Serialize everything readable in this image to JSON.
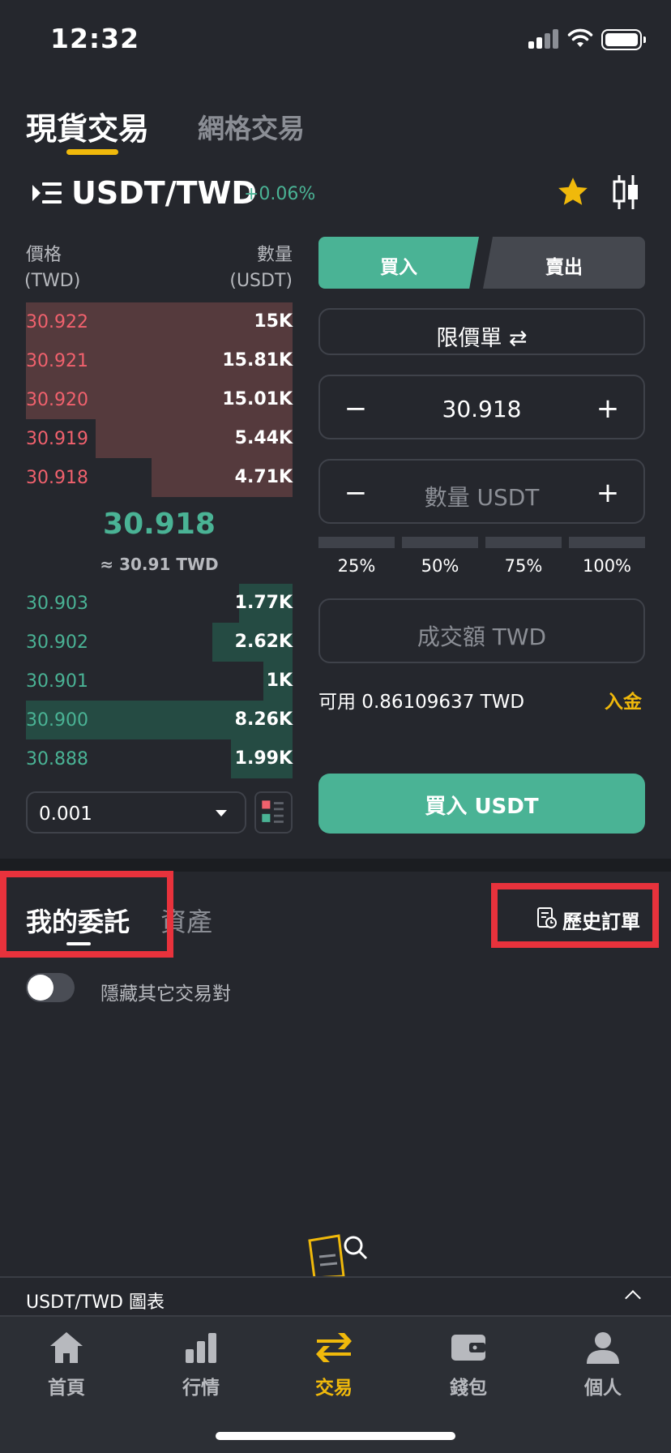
{
  "status_bar": {
    "time": "12:32"
  },
  "trade_tabs": {
    "spot": "現貨交易",
    "grid": "網格交易"
  },
  "pair": {
    "name": "USDT/TWD",
    "change": "+0.06%"
  },
  "orderbook": {
    "price_header": "價格",
    "price_unit": "(TWD)",
    "qty_header": "數量",
    "qty_unit": "(USDT)",
    "asks": [
      {
        "price": "30.922",
        "qty": "15K",
        "depth": 1.0
      },
      {
        "price": "30.921",
        "qty": "15.81K",
        "depth": 1.0
      },
      {
        "price": "30.920",
        "qty": "15.01K",
        "depth": 1.0
      },
      {
        "price": "30.919",
        "qty": "5.44K",
        "depth": 0.74
      },
      {
        "price": "30.918",
        "qty": "4.71K",
        "depth": 0.53
      }
    ],
    "last_price": "30.918",
    "last_price_fiat": "≈ 30.91 TWD",
    "bids": [
      {
        "price": "30.903",
        "qty": "1.77K",
        "depth": 0.2
      },
      {
        "price": "30.902",
        "qty": "2.62K",
        "depth": 0.3
      },
      {
        "price": "30.901",
        "qty": "1K",
        "depth": 0.11
      },
      {
        "price": "30.900",
        "qty": "8.26K",
        "depth": 1.0
      },
      {
        "price": "30.888",
        "qty": "1.99K",
        "depth": 0.23
      }
    ],
    "precision": "0.001"
  },
  "order_form": {
    "buy_label": "買入",
    "sell_label": "賣出",
    "order_type": "限價單",
    "price_value": "30.918",
    "qty_placeholder": "數量 USDT",
    "percents": [
      "25%",
      "50%",
      "75%",
      "100%"
    ],
    "total_placeholder": "成交額 TWD",
    "available": "可用 0.86109637 TWD",
    "deposit": "入金",
    "submit": "買入 USDT"
  },
  "orders": {
    "my_orders": "我的委託",
    "assets": "資產",
    "history": "歷史訂單",
    "hide_others": "隱藏其它交易對"
  },
  "chart_bar": {
    "label": "USDT/TWD 圖表"
  },
  "nav": {
    "items": [
      {
        "label": "首頁",
        "icon": "home-icon"
      },
      {
        "label": "行情",
        "icon": "market-icon"
      },
      {
        "label": "交易",
        "icon": "trade-icon"
      },
      {
        "label": "錢包",
        "icon": "wallet-icon"
      },
      {
        "label": "個人",
        "icon": "profile-icon"
      }
    ],
    "active": "交易"
  },
  "colors": {
    "accent": "#f0b90b",
    "buy": "#4ab395",
    "sell": "#f0616d",
    "highlight": "#e8323c"
  }
}
